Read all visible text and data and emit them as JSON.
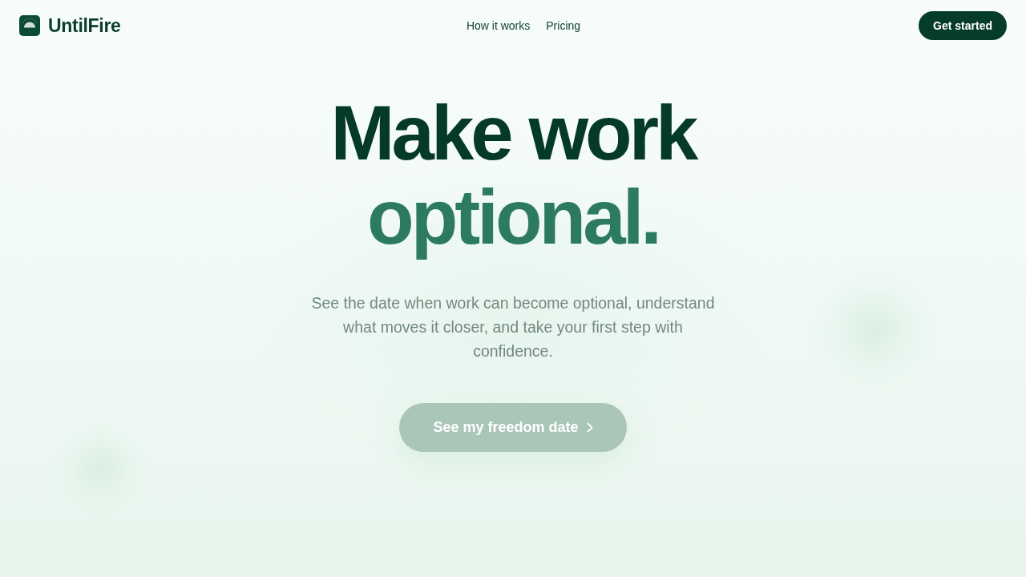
{
  "brand": {
    "name": "UntilFire"
  },
  "nav": {
    "links": [
      {
        "label": "How it works"
      },
      {
        "label": "Pricing"
      }
    ],
    "cta": {
      "label": "Get started"
    }
  },
  "hero": {
    "headline": [
      {
        "text": "Make work",
        "color": "#053a29"
      },
      {
        "text": "optional.",
        "color": "#2c7a5f"
      }
    ],
    "subtitle": "See the date when work can become optional, understand what moves it closer, and take your first step with confidence.",
    "cta": {
      "label": "See my freedom date",
      "disabled": true
    }
  }
}
